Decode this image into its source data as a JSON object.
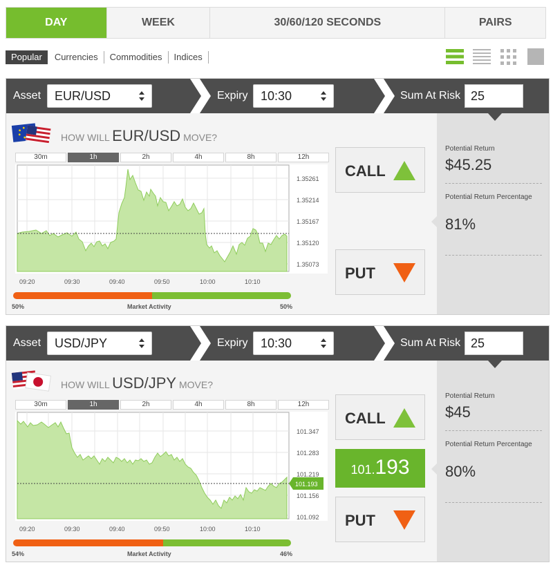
{
  "top_tabs": [
    {
      "label": "DAY"
    },
    {
      "label": "WEEK"
    },
    {
      "label": "30/60/120 SECONDS"
    },
    {
      "label": "PAIRS"
    }
  ],
  "filters": [
    "Popular",
    "Currencies",
    "Commodities",
    "Indices"
  ],
  "view_icons": [
    "list-large-icon",
    "list-compact-icon",
    "grid-icon",
    "single-icon"
  ],
  "colors": {
    "accent": "#76bd2e",
    "sell": "#f06014",
    "bar": "#4d4d4d"
  },
  "panels": [
    {
      "asset_label": "Asset",
      "asset": "EUR/USD",
      "expiry_label": "Expiry",
      "expiry": "10:30",
      "sum_label": "Sum At Risk",
      "sum": "25",
      "question_pre": "HOW WILL",
      "question_sym": "EUR/USD",
      "question_post": "MOVE?",
      "time_tabs": [
        "30m",
        "1h",
        "2h",
        "4h",
        "8h",
        "12h"
      ],
      "active_time_tab": "1h",
      "x_ticks": [
        "09:20",
        "09:30",
        "09:40",
        "09:50",
        "10:00",
        "10:10"
      ],
      "y_ticks": [
        "1.35261",
        "1.35214",
        "1.35167",
        "1.35120",
        "1.35073"
      ],
      "activity_label": "Market Activity",
      "sell_pct": "50%",
      "buy_pct": "50%",
      "sell_fraction": 0.5,
      "call_label": "CALL",
      "put_label": "PUT",
      "potential_return_label": "Potential Return",
      "potential_return": "$45.25",
      "return_pct_label": "Potential Return Percentage",
      "return_pct": "81%"
    },
    {
      "asset_label": "Asset",
      "asset": "USD/JPY",
      "expiry_label": "Expiry",
      "expiry": "10:30",
      "sum_label": "Sum At Risk",
      "sum": "25",
      "question_pre": "HOW WILL",
      "question_sym": "USD/JPY",
      "question_post": "MOVE?",
      "time_tabs": [
        "30m",
        "1h",
        "2h",
        "4h",
        "8h",
        "12h"
      ],
      "active_time_tab": "1h",
      "x_ticks": [
        "09:20",
        "09:30",
        "09:40",
        "09:50",
        "10:00",
        "10:10"
      ],
      "y_ticks": [
        "101.347",
        "101.283",
        "101.219",
        "101.156",
        "101.092"
      ],
      "current_price_tag": "101.193",
      "price_prefix": "101.",
      "price_main": "193",
      "activity_label": "Market Activity",
      "sell_pct": "54%",
      "buy_pct": "46%",
      "sell_fraction": 0.54,
      "call_label": "CALL",
      "put_label": "PUT",
      "potential_return_label": "Potential Return",
      "potential_return": "$45",
      "return_pct_label": "Potential Return Percentage",
      "return_pct": "80%"
    }
  ]
}
